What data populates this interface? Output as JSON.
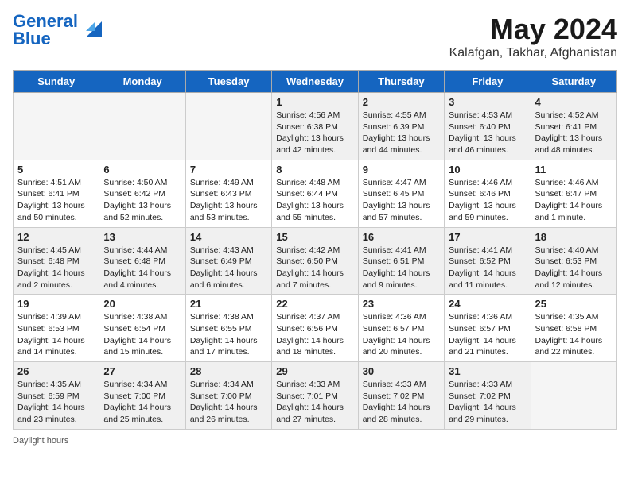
{
  "header": {
    "logo_line1": "General",
    "logo_line2": "Blue",
    "title": "May 2024",
    "subtitle": "Kalafgan, Takhar, Afghanistan"
  },
  "days_of_week": [
    "Sunday",
    "Monday",
    "Tuesday",
    "Wednesday",
    "Thursday",
    "Friday",
    "Saturday"
  ],
  "weeks": [
    [
      {
        "day": "",
        "info": "",
        "empty": true
      },
      {
        "day": "",
        "info": "",
        "empty": true
      },
      {
        "day": "",
        "info": "",
        "empty": true
      },
      {
        "day": "1",
        "info": "Sunrise: 4:56 AM\nSunset: 6:38 PM\nDaylight: 13 hours\nand 42 minutes.",
        "empty": false
      },
      {
        "day": "2",
        "info": "Sunrise: 4:55 AM\nSunset: 6:39 PM\nDaylight: 13 hours\nand 44 minutes.",
        "empty": false
      },
      {
        "day": "3",
        "info": "Sunrise: 4:53 AM\nSunset: 6:40 PM\nDaylight: 13 hours\nand 46 minutes.",
        "empty": false
      },
      {
        "day": "4",
        "info": "Sunrise: 4:52 AM\nSunset: 6:41 PM\nDaylight: 13 hours\nand 48 minutes.",
        "empty": false
      }
    ],
    [
      {
        "day": "5",
        "info": "Sunrise: 4:51 AM\nSunset: 6:41 PM\nDaylight: 13 hours\nand 50 minutes.",
        "empty": false
      },
      {
        "day": "6",
        "info": "Sunrise: 4:50 AM\nSunset: 6:42 PM\nDaylight: 13 hours\nand 52 minutes.",
        "empty": false
      },
      {
        "day": "7",
        "info": "Sunrise: 4:49 AM\nSunset: 6:43 PM\nDaylight: 13 hours\nand 53 minutes.",
        "empty": false
      },
      {
        "day": "8",
        "info": "Sunrise: 4:48 AM\nSunset: 6:44 PM\nDaylight: 13 hours\nand 55 minutes.",
        "empty": false
      },
      {
        "day": "9",
        "info": "Sunrise: 4:47 AM\nSunset: 6:45 PM\nDaylight: 13 hours\nand 57 minutes.",
        "empty": false
      },
      {
        "day": "10",
        "info": "Sunrise: 4:46 AM\nSunset: 6:46 PM\nDaylight: 13 hours\nand 59 minutes.",
        "empty": false
      },
      {
        "day": "11",
        "info": "Sunrise: 4:46 AM\nSunset: 6:47 PM\nDaylight: 14 hours\nand 1 minute.",
        "empty": false
      }
    ],
    [
      {
        "day": "12",
        "info": "Sunrise: 4:45 AM\nSunset: 6:48 PM\nDaylight: 14 hours\nand 2 minutes.",
        "empty": false
      },
      {
        "day": "13",
        "info": "Sunrise: 4:44 AM\nSunset: 6:48 PM\nDaylight: 14 hours\nand 4 minutes.",
        "empty": false
      },
      {
        "day": "14",
        "info": "Sunrise: 4:43 AM\nSunset: 6:49 PM\nDaylight: 14 hours\nand 6 minutes.",
        "empty": false
      },
      {
        "day": "15",
        "info": "Sunrise: 4:42 AM\nSunset: 6:50 PM\nDaylight: 14 hours\nand 7 minutes.",
        "empty": false
      },
      {
        "day": "16",
        "info": "Sunrise: 4:41 AM\nSunset: 6:51 PM\nDaylight: 14 hours\nand 9 minutes.",
        "empty": false
      },
      {
        "day": "17",
        "info": "Sunrise: 4:41 AM\nSunset: 6:52 PM\nDaylight: 14 hours\nand 11 minutes.",
        "empty": false
      },
      {
        "day": "18",
        "info": "Sunrise: 4:40 AM\nSunset: 6:53 PM\nDaylight: 14 hours\nand 12 minutes.",
        "empty": false
      }
    ],
    [
      {
        "day": "19",
        "info": "Sunrise: 4:39 AM\nSunset: 6:53 PM\nDaylight: 14 hours\nand 14 minutes.",
        "empty": false
      },
      {
        "day": "20",
        "info": "Sunrise: 4:38 AM\nSunset: 6:54 PM\nDaylight: 14 hours\nand 15 minutes.",
        "empty": false
      },
      {
        "day": "21",
        "info": "Sunrise: 4:38 AM\nSunset: 6:55 PM\nDaylight: 14 hours\nand 17 minutes.",
        "empty": false
      },
      {
        "day": "22",
        "info": "Sunrise: 4:37 AM\nSunset: 6:56 PM\nDaylight: 14 hours\nand 18 minutes.",
        "empty": false
      },
      {
        "day": "23",
        "info": "Sunrise: 4:36 AM\nSunset: 6:57 PM\nDaylight: 14 hours\nand 20 minutes.",
        "empty": false
      },
      {
        "day": "24",
        "info": "Sunrise: 4:36 AM\nSunset: 6:57 PM\nDaylight: 14 hours\nand 21 minutes.",
        "empty": false
      },
      {
        "day": "25",
        "info": "Sunrise: 4:35 AM\nSunset: 6:58 PM\nDaylight: 14 hours\nand 22 minutes.",
        "empty": false
      }
    ],
    [
      {
        "day": "26",
        "info": "Sunrise: 4:35 AM\nSunset: 6:59 PM\nDaylight: 14 hours\nand 23 minutes.",
        "empty": false
      },
      {
        "day": "27",
        "info": "Sunrise: 4:34 AM\nSunset: 7:00 PM\nDaylight: 14 hours\nand 25 minutes.",
        "empty": false
      },
      {
        "day": "28",
        "info": "Sunrise: 4:34 AM\nSunset: 7:00 PM\nDaylight: 14 hours\nand 26 minutes.",
        "empty": false
      },
      {
        "day": "29",
        "info": "Sunrise: 4:33 AM\nSunset: 7:01 PM\nDaylight: 14 hours\nand 27 minutes.",
        "empty": false
      },
      {
        "day": "30",
        "info": "Sunrise: 4:33 AM\nSunset: 7:02 PM\nDaylight: 14 hours\nand 28 minutes.",
        "empty": false
      },
      {
        "day": "31",
        "info": "Sunrise: 4:33 AM\nSunset: 7:02 PM\nDaylight: 14 hours\nand 29 minutes.",
        "empty": false
      },
      {
        "day": "",
        "info": "",
        "empty": true
      }
    ]
  ],
  "footer": {
    "daylight_label": "Daylight hours"
  }
}
